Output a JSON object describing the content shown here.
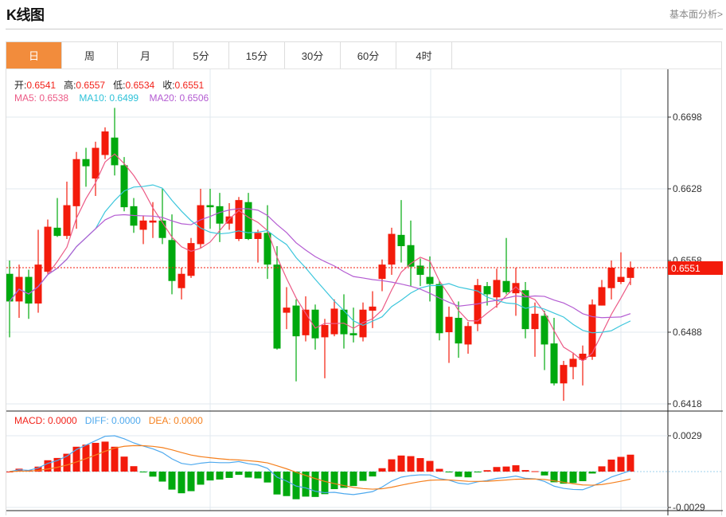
{
  "header": {
    "title": "K线图",
    "link": "基本面分析>"
  },
  "tabs": [
    {
      "label": "日",
      "active": true
    },
    {
      "label": "周"
    },
    {
      "label": "月"
    },
    {
      "label": "5分"
    },
    {
      "label": "15分"
    },
    {
      "label": "30分"
    },
    {
      "label": "60分"
    },
    {
      "label": "4时"
    }
  ],
  "ohlc_legend": {
    "open_label": "开:",
    "open": "0.6541",
    "high_label": "高:",
    "high": "0.6557",
    "low_label": "低:",
    "low": "0.6534",
    "close_label": "收:",
    "close": "0.6551"
  },
  "ma_legend": {
    "ma5": "MA5: 0.6538",
    "ma10": "MA10: 0.6499",
    "ma20": "MA20: 0.6506"
  },
  "macd_legend": {
    "macd": "MACD: 0.0000",
    "diff": "DIFF: 0.0000",
    "dea": "DEA: 0.0000"
  },
  "colors": {
    "up": "#f31b0b",
    "down": "#00a90e",
    "accent": "#f28c3c",
    "ma5": "#ec5a86",
    "ma10": "#3cc6dc",
    "ma20": "#b45cd2",
    "diff": "#4ea9ee",
    "dea": "#f5801e"
  },
  "chart_data": {
    "type": "candlestick",
    "price_axis_ticks": [
      "0.6698",
      "0.6628",
      "0.6558",
      "0.6488",
      "0.6418"
    ],
    "price_range": [
      0.6418,
      0.6698
    ],
    "current_price": "0.6551",
    "macd_axis_ticks": [
      "0.0029",
      "-0.0029"
    ],
    "grid": true,
    "candles": [
      [
        0.6545,
        0.6558,
        0.6483,
        0.6518
      ],
      [
        0.6518,
        0.6554,
        0.6502,
        0.6542
      ],
      [
        0.6542,
        0.6549,
        0.6501,
        0.6516
      ],
      [
        0.6516,
        0.6588,
        0.6507,
        0.6554
      ],
      [
        0.6547,
        0.6598,
        0.6545,
        0.6591
      ],
      [
        0.659,
        0.6619,
        0.6581,
        0.6582
      ],
      [
        0.6582,
        0.6635,
        0.6579,
        0.6612
      ],
      [
        0.6611,
        0.6664,
        0.6589,
        0.6657
      ],
      [
        0.6657,
        0.6668,
        0.663,
        0.665
      ],
      [
        0.6638,
        0.6674,
        0.6621,
        0.6668
      ],
      [
        0.6661,
        0.6688,
        0.6657,
        0.6684
      ],
      [
        0.6678,
        0.6707,
        0.6641,
        0.6651
      ],
      [
        0.6651,
        0.6659,
        0.6606,
        0.661
      ],
      [
        0.6611,
        0.6619,
        0.6585,
        0.6592
      ],
      [
        0.6588,
        0.6602,
        0.6574,
        0.6597
      ],
      [
        0.6595,
        0.6615,
        0.658,
        0.6597
      ],
      [
        0.6597,
        0.6628,
        0.6574,
        0.658
      ],
      [
        0.6578,
        0.6603,
        0.6525,
        0.6538
      ],
      [
        0.6531,
        0.6551,
        0.652,
        0.6545
      ],
      [
        0.6543,
        0.658,
        0.6541,
        0.6575
      ],
      [
        0.6574,
        0.6628,
        0.657,
        0.6612
      ],
      [
        0.6612,
        0.6628,
        0.6589,
        0.661
      ],
      [
        0.6611,
        0.6624,
        0.6576,
        0.6594
      ],
      [
        0.6594,
        0.6614,
        0.6588,
        0.6601
      ],
      [
        0.6579,
        0.662,
        0.6577,
        0.6617
      ],
      [
        0.6615,
        0.6624,
        0.6578,
        0.6579
      ],
      [
        0.6579,
        0.6588,
        0.6556,
        0.6585
      ],
      [
        0.6585,
        0.6612,
        0.654,
        0.6554
      ],
      [
        0.6554,
        0.6572,
        0.6471,
        0.6472
      ],
      [
        0.6507,
        0.6532,
        0.6491,
        0.6512
      ],
      [
        0.6514,
        0.652,
        0.644,
        0.6484
      ],
      [
        0.6485,
        0.6523,
        0.6479,
        0.651
      ],
      [
        0.651,
        0.6515,
        0.6471,
        0.6482
      ],
      [
        0.6483,
        0.6501,
        0.6443,
        0.6495
      ],
      [
        0.6486,
        0.652,
        0.6484,
        0.6511
      ],
      [
        0.651,
        0.6525,
        0.6472,
        0.6486
      ],
      [
        0.6487,
        0.6512,
        0.6478,
        0.6485
      ],
      [
        0.6483,
        0.6517,
        0.6479,
        0.651
      ],
      [
        0.6509,
        0.6528,
        0.6492,
        0.6513
      ],
      [
        0.654,
        0.6559,
        0.6528,
        0.6554
      ],
      [
        0.6554,
        0.659,
        0.6544,
        0.6584
      ],
      [
        0.6583,
        0.6617,
        0.6556,
        0.6572
      ],
      [
        0.6573,
        0.6597,
        0.6533,
        0.6552
      ],
      [
        0.6553,
        0.656,
        0.6533,
        0.6544
      ],
      [
        0.6542,
        0.6562,
        0.6518,
        0.6535
      ],
      [
        0.6535,
        0.6538,
        0.648,
        0.6487
      ],
      [
        0.6488,
        0.6513,
        0.6458,
        0.6503
      ],
      [
        0.6502,
        0.6518,
        0.6463,
        0.6477
      ],
      [
        0.6476,
        0.6498,
        0.6467,
        0.6494
      ],
      [
        0.6496,
        0.654,
        0.6489,
        0.6534
      ],
      [
        0.6533,
        0.6537,
        0.6514,
        0.6525
      ],
      [
        0.6522,
        0.655,
        0.6512,
        0.6539
      ],
      [
        0.6538,
        0.658,
        0.6525,
        0.6527
      ],
      [
        0.6526,
        0.6551,
        0.6504,
        0.6536
      ],
      [
        0.6529,
        0.6537,
        0.6482,
        0.6491
      ],
      [
        0.6491,
        0.6517,
        0.6464,
        0.6506
      ],
      [
        0.6504,
        0.6509,
        0.6451,
        0.6476
      ],
      [
        0.6477,
        0.6502,
        0.6436,
        0.6438
      ],
      [
        0.6438,
        0.646,
        0.6421,
        0.6456
      ],
      [
        0.6454,
        0.6468,
        0.6442,
        0.6462
      ],
      [
        0.6461,
        0.6475,
        0.6436,
        0.6467
      ],
      [
        0.6464,
        0.652,
        0.6461,
        0.6515
      ],
      [
        0.6514,
        0.6539,
        0.6514,
        0.6532
      ],
      [
        0.6531,
        0.6558,
        0.652,
        0.6551
      ],
      [
        0.6537,
        0.6566,
        0.6535,
        0.6542
      ],
      [
        0.6541,
        0.6557,
        0.6534,
        0.6551
      ]
    ],
    "candle_format": [
      "open",
      "high",
      "low",
      "close"
    ],
    "moving_averages": [
      "MA5",
      "MA10",
      "MA20"
    ],
    "indicator": "MACD"
  }
}
